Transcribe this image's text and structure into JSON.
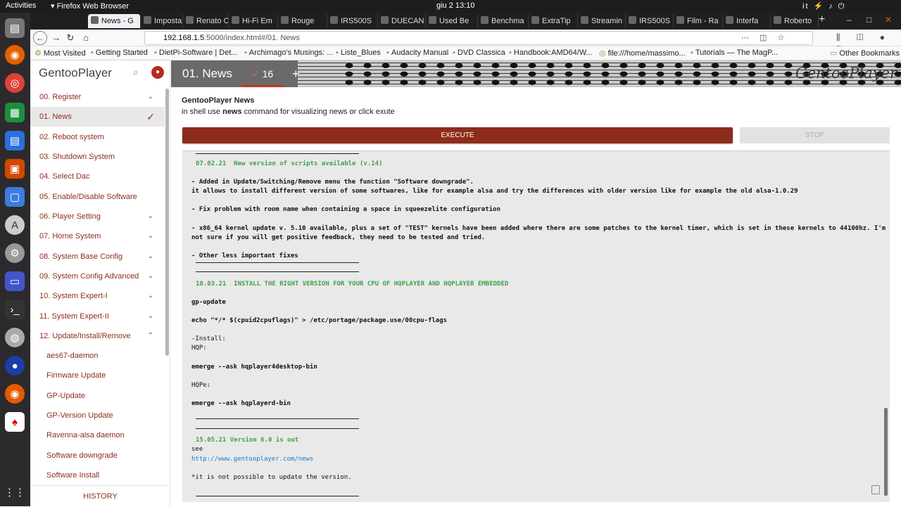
{
  "os": {
    "activities": "Activities",
    "app_name": "Firefox Web Browser",
    "clock": "giu 2  13:10",
    "locale": "it"
  },
  "browser": {
    "tabs": [
      {
        "label": "News - G"
      },
      {
        "label": "Impostaz"
      },
      {
        "label": "Renato C"
      },
      {
        "label": "Hi-Fi Em"
      },
      {
        "label": "Rouge"
      },
      {
        "label": "IRS500S"
      },
      {
        "label": "DUECAN"
      },
      {
        "label": "Used Be"
      },
      {
        "label": "Benchma"
      },
      {
        "label": "ExtraTip"
      },
      {
        "label": "Streamin"
      },
      {
        "label": "IRS500S"
      },
      {
        "label": "Film - Ra"
      },
      {
        "label": "Interfa"
      },
      {
        "label": "Roberto"
      }
    ],
    "url_host": "192.168.1.5",
    "url_rest": ":5000/index.html#/01. News",
    "bookmarks": [
      "Most Visited",
      "Getting Started",
      "DietPi-Software | Det...",
      "Archimago's Musings: ...",
      "Liste_Blues",
      "Audacity Manual",
      "DVD Classica",
      "Handbook:AMD64/W...",
      "file:///home/massimo...",
      "Tutorials — The MagP...",
      "Other Bookmarks"
    ]
  },
  "sidebar": {
    "title": "GentooPlayer",
    "items": [
      {
        "label": "00. Register"
      },
      {
        "label": "01. News"
      },
      {
        "label": "02. Reboot system"
      },
      {
        "label": "03. Shutdown System"
      },
      {
        "label": "04. Select Dac"
      },
      {
        "label": "05. Enable/Disable Software"
      },
      {
        "label": "06. Player Setting"
      },
      {
        "label": "07. Home System"
      },
      {
        "label": "08. System Base Config"
      },
      {
        "label": "09. System Config Advanced"
      },
      {
        "label": "10. System Expert-I"
      },
      {
        "label": "11. System Expert-II"
      },
      {
        "label": "12. Update/Install/Remove"
      }
    ],
    "subitems": [
      {
        "label": "aes67-daemon"
      },
      {
        "label": "Firmware Update"
      },
      {
        "label": "GP-Update"
      },
      {
        "label": "GP-Version Update"
      },
      {
        "label": "Ravenna-alsa daemon"
      },
      {
        "label": "Software downgrade"
      },
      {
        "label": "Software Install"
      }
    ],
    "history": "HISTORY"
  },
  "header": {
    "tab1": "01. News",
    "tab2_count": "16",
    "brand": "GentooPlayer"
  },
  "content": {
    "title": "GentooPlayer News",
    "desc_pre": "in shell use ",
    "desc_cmd": "news",
    "desc_post": " command for visualizing news or click exute",
    "execute": "EXECUTE",
    "stop": "STOP"
  },
  "terminal": {
    "lines": [
      "07.02.21  New version of scripts available (v.14)",
      "- Added in Update/Switching/Remove menu the function \"Software downgrade\".",
      "it allows to install different version of some softwares, like for example alsa and try the differences with older version like for example the old alsa-1.0.29",
      "- Fix problem with room name when containing a space in squeezelite configuration",
      "- x86_64 kernel update v. 5.10 available, plus a set of \"TEST\" kernels have been added where there are some patches to the kernel timer, which is set in these kernels to 44100hz. I'm",
      "not sure if you will get positive feedback, they need to be tested and tried.",
      "- Other less important fixes",
      "10.03.21  INSTALL THE RIGHT VERSION FOR YOUR CPU OF HQPLAYER AND HQPLAYER EMBEDDED",
      "gp-update",
      "echo \"*/* $(cpuid2cpuflags)\" > /etc/portage/package.use/00cpu-flags",
      "-Install:",
      "HQP:",
      "emerge --ask hqplayer4desktop-bin",
      "HQPe:",
      "emerge --ask hqplayerd-bin",
      "15.05.21 Version 6.0 is out",
      "see",
      "http://www.gentooplayer.com/news",
      "*it is not possible to update the version."
    ]
  },
  "colors": {
    "accent": "#8e2c1c",
    "green": "#43a047",
    "link": "#1e7bc3"
  }
}
